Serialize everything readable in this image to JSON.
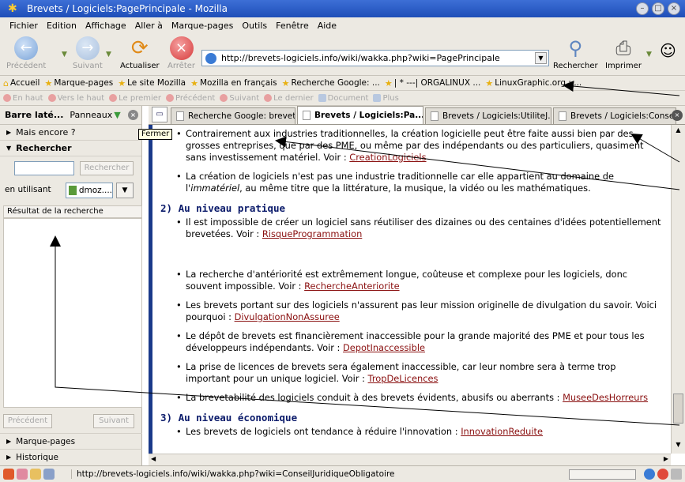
{
  "window": {
    "title": "Brevets / Logiciels:PagePrincipale - Mozilla"
  },
  "menu": [
    "Fichier",
    "Edition",
    "Affichage",
    "Aller à",
    "Marque-pages",
    "Outils",
    "Fenêtre",
    "Aide"
  ],
  "nav": {
    "back": "Précédent",
    "forward": "Suivant",
    "reload": "Actualiser",
    "stop": "Arrêter",
    "url": "http://brevets-logiciels.info/wiki/wakka.php?wiki=PagePrincipale",
    "search": "Rechercher",
    "print": "Imprimer"
  },
  "bookmarks": [
    "Accueil",
    "Marque-pages",
    "Le site Mozilla",
    "Mozilla en français",
    "Recherche Google: ...",
    "| * ---| ORGALINUX ...",
    "LinuxGraphic.org : ..."
  ],
  "linkbar": [
    "En haut",
    "Vers le haut",
    "Le premier",
    "Précédent",
    "Suivant",
    "Le dernier",
    "Document",
    "Plus"
  ],
  "sidebar": {
    "title": "Barre laté...",
    "panels": "Panneaux",
    "more": "Mais encore ?",
    "search_section": "Rechercher",
    "search_button": "Rechercher",
    "using_label": "en utilisant",
    "engine": "dmoz....",
    "results_header": "Résultat de la recherche",
    "prev_button": "Précédent",
    "next_button": "Suivant",
    "bookmarks": "Marque-pages",
    "history": "Historique"
  },
  "tabs": [
    {
      "label": "Recherche Google: brevet...",
      "active": false
    },
    {
      "label": "Brevets / Logiciels:Pa...",
      "active": true
    },
    {
      "label": "Brevets / Logiciels:UtiliteJ...",
      "active": false
    },
    {
      "label": "Brevets / Logiciels:Conse...",
      "active": false
    }
  ],
  "tooltip": "Fermer",
  "content": {
    "b1_text": "Contrairement aux industries traditionnelles, la création logicielle peut être faite aussi bien par des grosses entreprises, que par des PME, ou même par des indépendants ou des particuliers, quasiment sans investissement matériel. Voir : ",
    "b1_link": "CreationLogiciels",
    "b2_pre": "La création de logiciels n'est pas une industrie traditionnelle car elle appartient au domaine de l'",
    "b2_em": "immatériel",
    "b2_post": ", au même titre que la littérature, la musique, la vidéo ou les mathématiques.",
    "h2": "2) Au niveau pratique",
    "b3_text": "Il est impossible de créer un logiciel sans réutiliser des dizaines ou des centaines d'idées potentiellement brevetées. Voir : ",
    "b3_link": "RisqueProgrammation",
    "b4_text": "La recherche d'antériorité est extrêmement longue, coûteuse et complexe pour les logiciels, donc souvent impossible. Voir : ",
    "b4_link": "RechercheAnteriorite",
    "b5_text": "Les brevets portant sur des logiciels n'assurent pas leur mission originelle de divulgation du savoir. Voici pourquoi : ",
    "b5_link": "DivulgationNonAssuree",
    "b6_text": "Le dépôt de brevets est financièrement inaccessible pour la grande majorité des PME et pour tous les développeurs indépendants. Voir : ",
    "b6_link": "DepotInaccessible",
    "b7_text": "La prise de licences de brevets sera également inaccessible, car leur nombre sera à terme trop important pour un unique logiciel. Voir : ",
    "b7_link": "TropDeLicences",
    "b8_text": "La brevetabilité des logiciels conduit à des brevets évidents, abusifs ou aberrants : ",
    "b8_link": "MuseeDesHorreurs",
    "h3": "3) Au niveau économique",
    "b9_text": "Les brevets de logiciels ont tendance à réduire l'innovation : ",
    "b9_link": "InnovationReduite"
  },
  "status": {
    "text": "http://brevets-logiciels.info/wiki/wakka.php?wiki=ConseilJuridiqueObligatoire"
  }
}
